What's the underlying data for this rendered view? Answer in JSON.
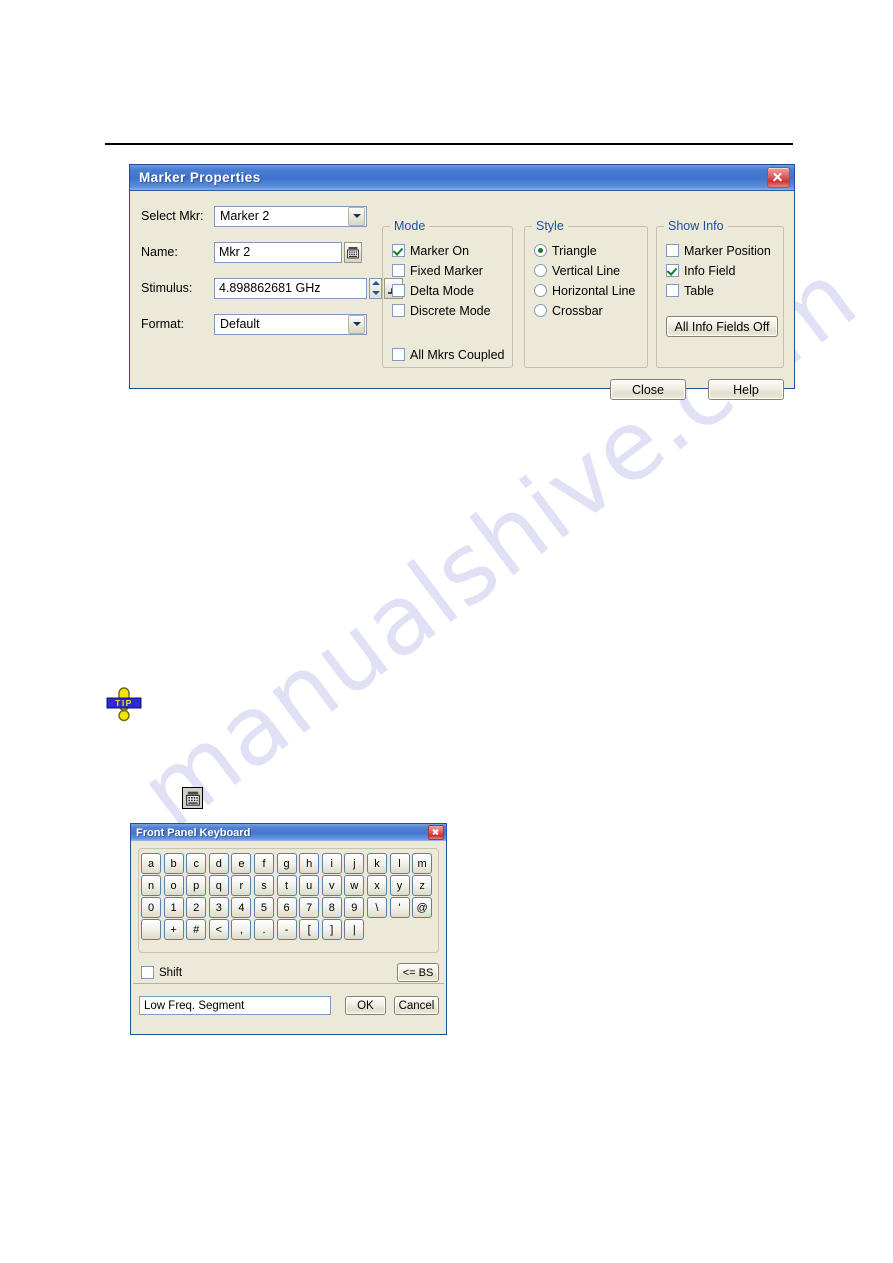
{
  "watermark": {
    "text": "manualshive.com"
  },
  "marker_dialog": {
    "title": "Marker Properties",
    "close_icon": "close-icon",
    "fields": [
      {
        "label": "Select Mkr:",
        "type": "combo",
        "value": "Marker 2"
      },
      {
        "label": "Name:",
        "type": "text",
        "value": "Mkr 2"
      },
      {
        "label": "Stimulus:",
        "type": "text",
        "value": "4.898862681 GHz"
      },
      {
        "label": "Format:",
        "type": "combo",
        "value": "Default"
      }
    ],
    "name_keyboard_icon": "keyboard-icon",
    "stimulus_spinner_icon": "spinner-updown-icon",
    "stimulus_step_icon": "step-size-icon",
    "mode_group": {
      "legend": "Mode",
      "items": [
        {
          "label": "Marker On",
          "checked": true
        },
        {
          "label": "Fixed Marker",
          "checked": false
        },
        {
          "label": "Delta Mode",
          "checked": false
        },
        {
          "label": "Discrete Mode",
          "checked": false
        }
      ],
      "coupled": {
        "label": "All Mkrs Coupled",
        "checked": false
      }
    },
    "style_group": {
      "legend": "Style",
      "items": [
        {
          "label": "Triangle",
          "selected": true
        },
        {
          "label": "Vertical Line",
          "selected": false
        },
        {
          "label": "Horizontal Line",
          "selected": false
        },
        {
          "label": "Crossbar",
          "selected": false
        }
      ]
    },
    "show_info_group": {
      "legend": "Show Info",
      "items": [
        {
          "label": "Marker Position",
          "checked": false
        },
        {
          "label": "Info Field",
          "checked": true
        },
        {
          "label": "Table",
          "checked": false
        }
      ],
      "all_off_button": "All Info Fields Off"
    },
    "buttons": {
      "close": "Close",
      "help": "Help"
    }
  },
  "tip_icon": {
    "label": "TIP",
    "banner_color": "#2a2ad6",
    "mark_color": "#f5e400"
  },
  "inline_keyboard_icon": "keyboard-icon",
  "fpk_dialog": {
    "title": "Front Panel Keyboard",
    "close_icon": "close-icon",
    "key_rows": [
      [
        "a",
        "b",
        "c",
        "d",
        "e",
        "f",
        "g",
        "h",
        "i",
        "j",
        "k",
        "l",
        "m"
      ],
      [
        "n",
        "o",
        "p",
        "q",
        "r",
        "s",
        "t",
        "u",
        "v",
        "w",
        "x",
        "y",
        "z"
      ],
      [
        "0",
        "1",
        "2",
        "3",
        "4",
        "5",
        "6",
        "7",
        "8",
        "9",
        "\\",
        "'",
        "@"
      ],
      [
        "",
        "+",
        "#",
        "<",
        ",",
        ".",
        "-",
        "[",
        "]",
        "|"
      ]
    ],
    "shift": {
      "label": "Shift",
      "checked": false
    },
    "backspace_label": "<= BS",
    "entry_value": "Low Freq. Segment",
    "ok_label": "OK",
    "cancel_label": "Cancel"
  }
}
